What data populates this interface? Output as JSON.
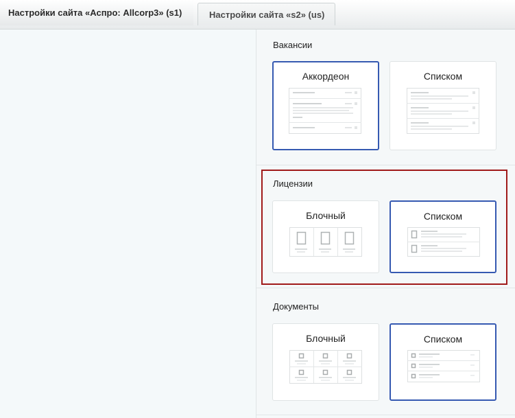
{
  "tabs": [
    {
      "label": "Настройки сайта «Аспро: Allcorp3» (s1)",
      "active": true
    },
    {
      "label": "Настройки сайта «s2» (us)",
      "active": false
    }
  ],
  "sections": {
    "vacancies": {
      "title": "Вакансии",
      "options": [
        {
          "label": "Аккордеон",
          "selected": true
        },
        {
          "label": "Списком",
          "selected": false
        }
      ]
    },
    "licenses": {
      "title": "Лицензии",
      "options": [
        {
          "label": "Блочный",
          "selected": false
        },
        {
          "label": "Списком",
          "selected": true
        }
      ]
    },
    "documents": {
      "title": "Документы",
      "options": [
        {
          "label": "Блочный",
          "selected": false
        },
        {
          "label": "Списком",
          "selected": true
        }
      ]
    }
  },
  "colors": {
    "selected_border": "#3559b1",
    "highlight_border": "#a01919"
  }
}
